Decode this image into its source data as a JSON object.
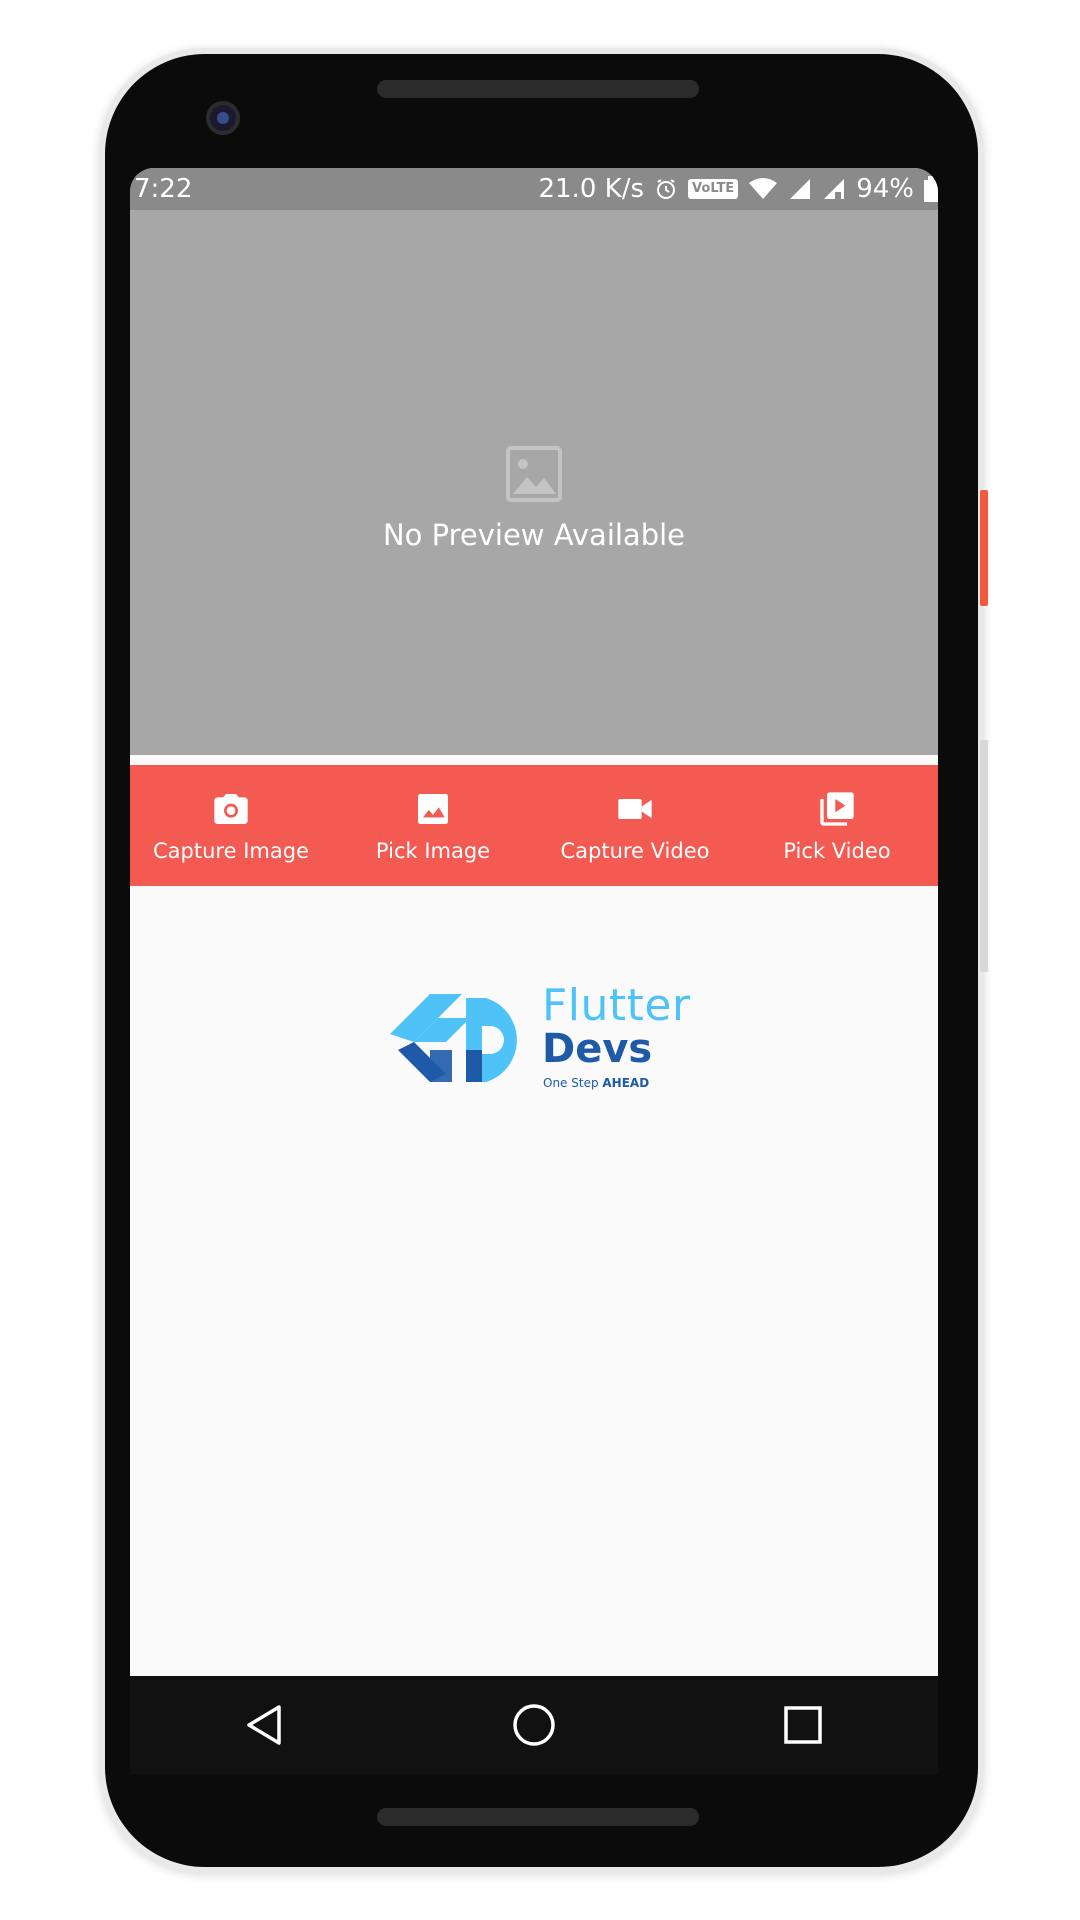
{
  "status_bar": {
    "time": "7:22",
    "network_speed": "21.0 K/s",
    "volte_label": "VoLTE",
    "battery": "94%",
    "icons": [
      "alarm-icon",
      "wifi-icon",
      "signal-icon",
      "signal-roaming-icon",
      "battery-icon"
    ]
  },
  "preview": {
    "icon": "image-placeholder-icon",
    "text": "No Preview Available"
  },
  "actions": [
    {
      "label": "Capture Image",
      "icon": "camera-icon"
    },
    {
      "label": "Pick Image",
      "icon": "image-icon"
    },
    {
      "label": "Capture Video",
      "icon": "videocam-icon"
    },
    {
      "label": "Pick Video",
      "icon": "video-library-icon"
    }
  ],
  "logo": {
    "flutter": "Flutter",
    "devs": "Devs",
    "tagline_prefix": "One Step ",
    "tagline_bold": "AHEAD"
  },
  "nav": {
    "icons": [
      "back-icon",
      "home-icon",
      "recents-icon"
    ]
  },
  "colors": {
    "action_bar": "#f25a52",
    "preview_bg": "#a7a7a7",
    "status_bar": "#8a8a8a",
    "logo_light": "#4fc3f7",
    "logo_dark": "#1e5aa8"
  }
}
